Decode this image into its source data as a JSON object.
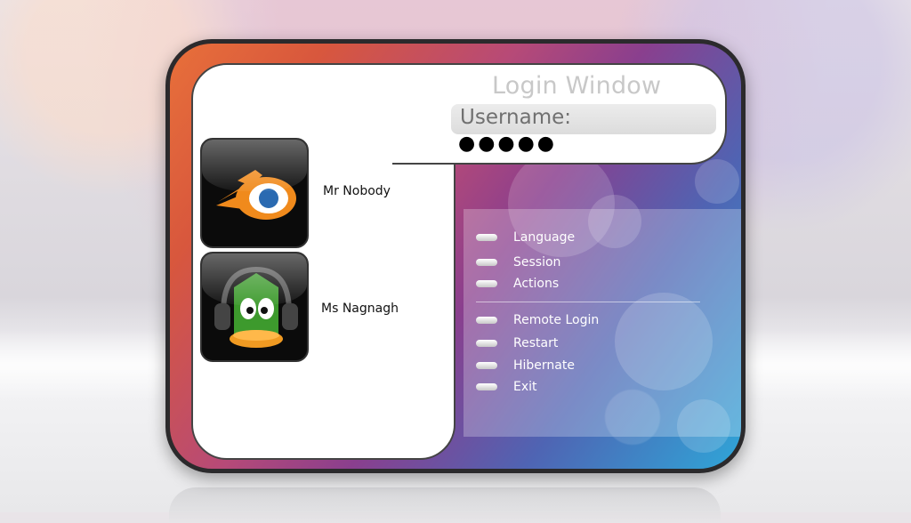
{
  "login": {
    "title": "Login Window",
    "username_label": "Username:",
    "password_masked": "●●●●●"
  },
  "users": [
    {
      "name": "Mr Nobody",
      "icon": "blender-icon"
    },
    {
      "name": "Ms Nagnagh",
      "icon": "duck-headphones-icon"
    }
  ],
  "menu": {
    "items": [
      {
        "label": "Language"
      },
      {
        "label": "Session"
      },
      {
        "label": "Actions"
      },
      {
        "label": "Remote Login"
      },
      {
        "label": "Restart"
      },
      {
        "label": "Hibernate"
      },
      {
        "label": "Exit"
      }
    ]
  },
  "colors": {
    "frame_border": "#2b2a2c",
    "gradient_start": "#e8703a",
    "gradient_mid": "#8a3f8e",
    "gradient_end": "#2fa6d8"
  }
}
